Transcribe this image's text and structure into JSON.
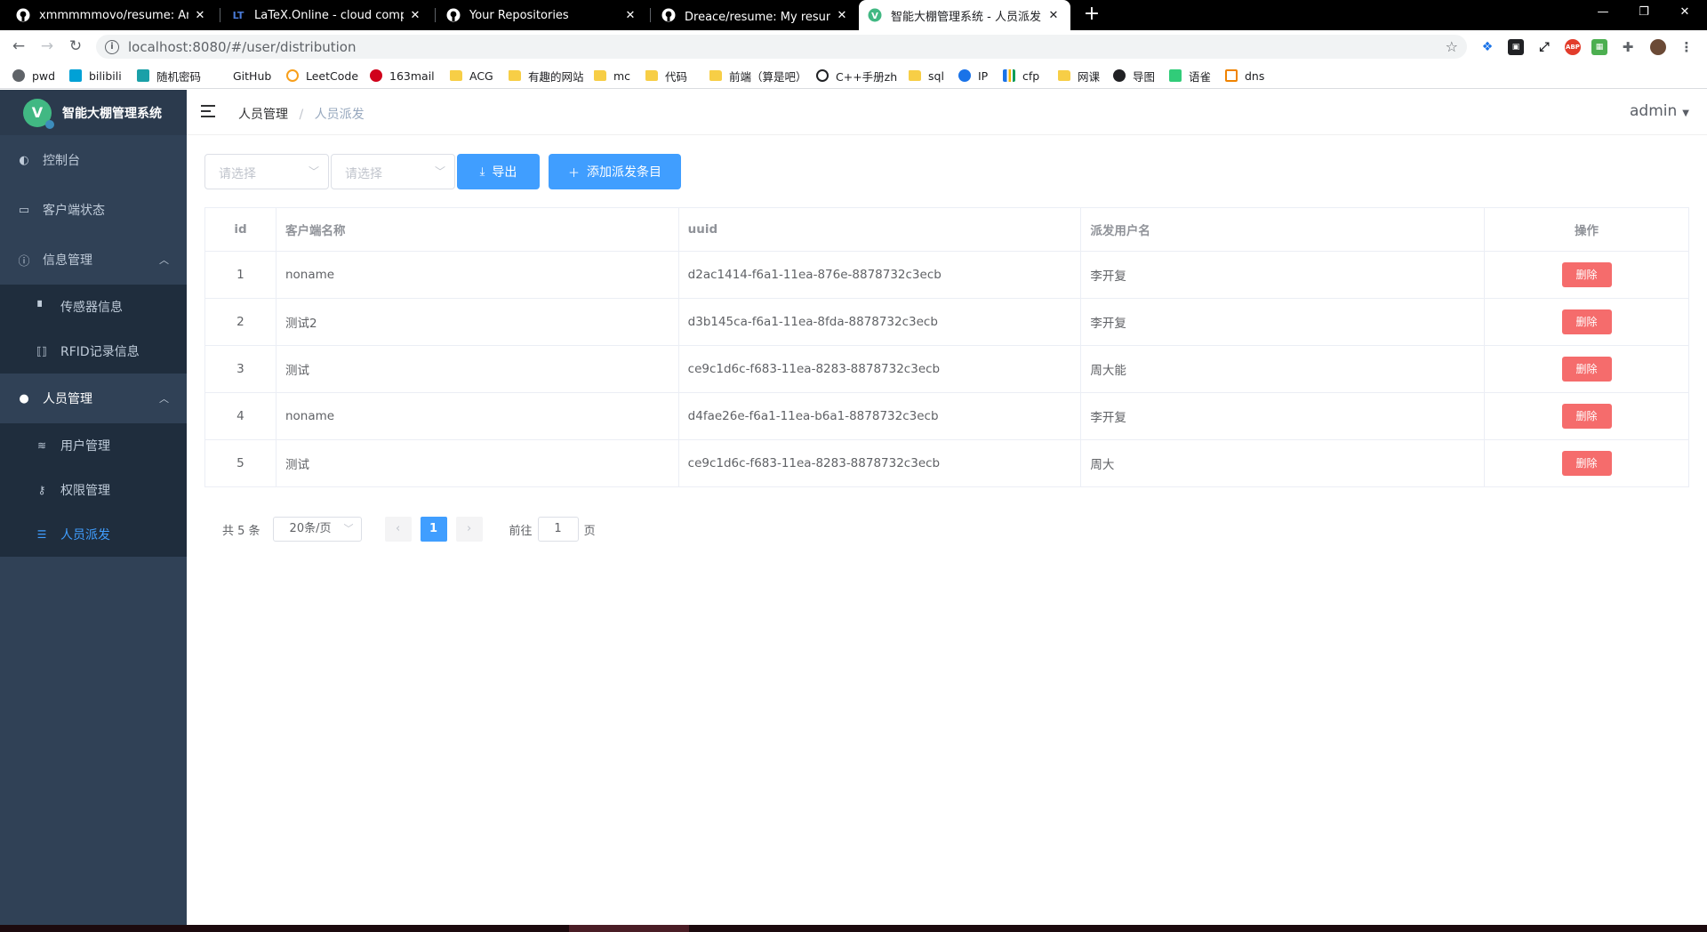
{
  "browser": {
    "tabs": [
      {
        "title": "xmmmmmovo/resume: An ele",
        "icon": "github-icon"
      },
      {
        "title": "LaTeX.Online - cloud compiler",
        "icon": "latex-icon"
      },
      {
        "title": "Your Repositories",
        "icon": "github-icon"
      },
      {
        "title": "Dreace/resume: My resume/个",
        "icon": "github-icon"
      },
      {
        "title": "智能大棚管理系统 - 人员派发",
        "icon": "vue-icon",
        "active": true
      }
    ],
    "url": "localhost:8080/#/user/distribution",
    "bookmarks": [
      {
        "label": "pwd",
        "icon": "gear-icon"
      },
      {
        "label": "bilibili",
        "icon": "bilibili-icon"
      },
      {
        "label": "随机密码",
        "icon": "checkbox-icon"
      },
      {
        "label": "GitHub",
        "icon": "github-icon"
      },
      {
        "label": "LeetCode",
        "icon": "leetcode-icon"
      },
      {
        "label": "163mail",
        "icon": "mail-icon"
      },
      {
        "label": "ACG",
        "icon": "folder-icon"
      },
      {
        "label": "有趣的网站",
        "icon": "folder-icon"
      },
      {
        "label": "mc",
        "icon": "folder-icon"
      },
      {
        "label": "代码",
        "icon": "folder-icon"
      },
      {
        "label": "前端（算是吧）",
        "icon": "folder-icon"
      },
      {
        "label": "C++手册zh",
        "icon": "cpp-icon"
      },
      {
        "label": "sql",
        "icon": "folder-icon"
      },
      {
        "label": "IP",
        "icon": "ip-icon"
      },
      {
        "label": "cfp",
        "icon": "chart-icon"
      },
      {
        "label": "网课",
        "icon": "folder-icon"
      },
      {
        "label": "导图",
        "icon": "owl-icon"
      },
      {
        "label": "语雀",
        "icon": "yuque-icon"
      },
      {
        "label": "dns",
        "icon": "dns-icon"
      }
    ]
  },
  "app": {
    "logo_text": "智能大棚管理系统",
    "logo_letter": "V",
    "menu": {
      "dashboard": "控制台",
      "client_status": "客户端状态",
      "info_mgmt": "信息管理",
      "sensor_info": "传感器信息",
      "rfid_info": "RFID记录信息",
      "people_mgmt": "人员管理",
      "user_mgmt": "用户管理",
      "perm_mgmt": "权限管理",
      "distribution": "人员派发"
    },
    "breadcrumb": {
      "parent": "人员管理",
      "sep": "/",
      "current": "人员派发"
    },
    "user": "admin"
  },
  "filters": {
    "select1_placeholder": "请选择",
    "select2_placeholder": "请选择",
    "export_label": "导出",
    "add_label": "添加派发条目"
  },
  "table": {
    "headers": {
      "id": "id",
      "client": "客户端名称",
      "uuid": "uuid",
      "user": "派发用户名",
      "op": "操作"
    },
    "delete_label": "删除",
    "rows": [
      {
        "id": "1",
        "client": "noname",
        "uuid": "d2ac1414-f6a1-11ea-876e-8878732c3ecb",
        "user": "李开复"
      },
      {
        "id": "2",
        "client": "测试2",
        "uuid": "d3b145ca-f6a1-11ea-8fda-8878732c3ecb",
        "user": "李开复"
      },
      {
        "id": "3",
        "client": "测试",
        "uuid": "ce9c1d6c-f683-11ea-8283-8878732c3ecb",
        "user": "周大能"
      },
      {
        "id": "4",
        "client": "noname",
        "uuid": "d4fae26e-f6a1-11ea-b6a1-8878732c3ecb",
        "user": "李开复"
      },
      {
        "id": "5",
        "client": "测试",
        "uuid": "ce9c1d6c-f683-11ea-8283-8878732c3ecb",
        "user": "周大"
      }
    ]
  },
  "pagination": {
    "total": "共 5 条",
    "page_size": "20条/页",
    "current_page": "1",
    "goto_prefix": "前往",
    "goto_value": "1",
    "goto_suffix": "页"
  },
  "colors": {
    "primary": "#409eff",
    "danger": "#f56c6c",
    "sidebar": "#304156",
    "submenu": "#1f2d3d"
  }
}
